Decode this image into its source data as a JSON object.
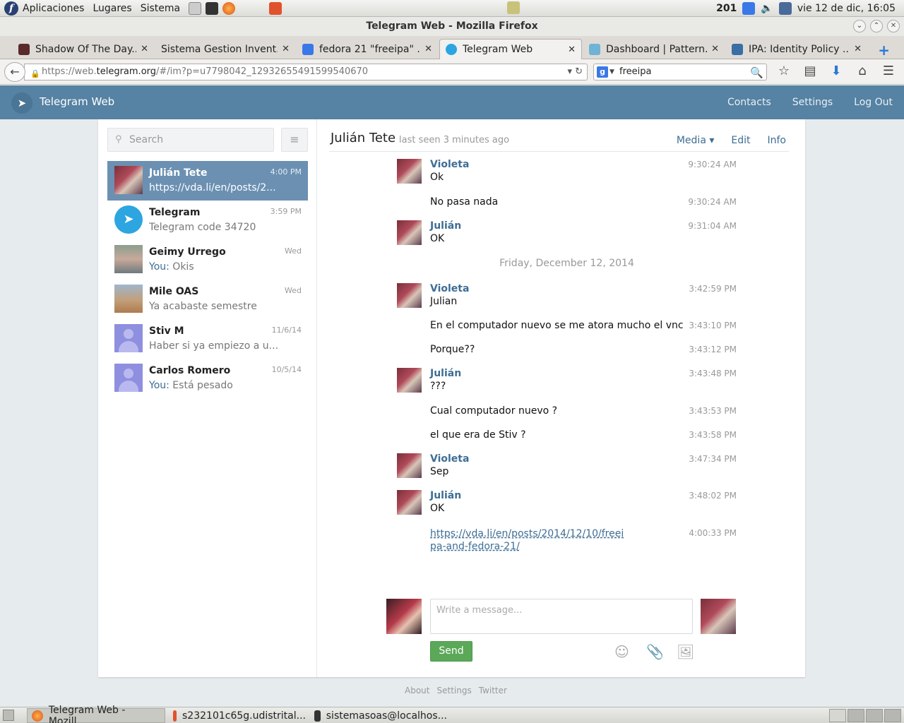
{
  "gnome_panel": {
    "menus": [
      "Aplicaciones",
      "Lugares",
      "Sistema"
    ],
    "tray_number": "201",
    "clock": "vie 12 de dic, 16:05"
  },
  "window": {
    "title": "Telegram Web - Mozilla Firefox"
  },
  "tabs": [
    {
      "title": "Shadow Of The Day...",
      "favicon_color": "#5a2a2a"
    },
    {
      "title": "Sistema Gestion Invent...",
      "favicon_color": "#dedbd6"
    },
    {
      "title": "fedora 21 \"freeipa\" ...",
      "favicon_color": "#3b78e7"
    },
    {
      "title": "Telegram Web",
      "favicon_color": "#2ca5e0"
    },
    {
      "title": "Dashboard | Pattern...",
      "favicon_color": "#6fb3d6"
    },
    {
      "title": "IPA: Identity Policy ...",
      "favicon_color": "#3a6ea5"
    }
  ],
  "nav": {
    "url_prefix": "https://web.",
    "url_host": "telegram.org",
    "url_rest": "/#/im?p=u7798042_12932655491599540670",
    "search_value": "freeipa"
  },
  "tg_header": {
    "brand": "Telegram Web",
    "links": [
      "Contacts",
      "Settings",
      "Log Out"
    ]
  },
  "sidebar": {
    "search_placeholder": "Search",
    "dialogs": [
      {
        "name": "Julián Tete",
        "time": "4:00 PM",
        "you": "",
        "preview": "https://vda.li/en/posts/2...",
        "avatar": "photo-julian",
        "active": true
      },
      {
        "name": "Telegram",
        "time": "3:59 PM",
        "you": "",
        "preview": "Telegram code 34720",
        "avatar": "telegram-logo",
        "active": false
      },
      {
        "name": "Geimy Urrego",
        "time": "Wed",
        "you": "You:",
        "preview": " Okis",
        "avatar": "photo-geimy",
        "active": false
      },
      {
        "name": "Mile OAS",
        "time": "Wed",
        "you": "",
        "preview": "Ya acabaste semestre",
        "avatar": "photo-mile",
        "active": false
      },
      {
        "name": "Stiv M",
        "time": "11/6/14",
        "you": "",
        "preview": "Haber si ya empiezo a u...",
        "avatar": "person-placeholder",
        "active": false
      },
      {
        "name": "Carlos Romero",
        "time": "10/5/14",
        "you": "You:",
        "preview": " Está pesado",
        "avatar": "person-placeholder",
        "active": false
      }
    ]
  },
  "chat": {
    "peer_name": "Julián Tete",
    "peer_status": "last seen 3 minutes ago",
    "actions": [
      "Media ▾",
      "Edit",
      "Info"
    ],
    "date_separator": "Friday, December 12, 2014",
    "messages": [
      {
        "author": "Violeta",
        "text": "Ok",
        "time": "9:30:24 AM"
      },
      {
        "author": "",
        "text": "No pasa nada",
        "time": "9:30:24 AM"
      },
      {
        "author": "Julián",
        "text": "OK",
        "time": "9:31:04 AM"
      },
      {
        "author": "Violeta",
        "text": "Julian",
        "time": "3:42:59 PM"
      },
      {
        "author": "",
        "text": "En el computador nuevo se me atora mucho el vnc",
        "time": "3:43:10 PM"
      },
      {
        "author": "",
        "text": "Porque??",
        "time": "3:43:12 PM"
      },
      {
        "author": "Julián",
        "text": "???",
        "time": "3:43:48 PM"
      },
      {
        "author": "",
        "text": "Cual computador nuevo ?",
        "time": "3:43:53 PM"
      },
      {
        "author": "",
        "text": "el que era de Stiv ?",
        "time": "3:43:58 PM"
      },
      {
        "author": "Violeta",
        "text": "Sep",
        "time": "3:47:34 PM"
      },
      {
        "author": "Julián",
        "text": "OK",
        "time": "3:48:02 PM"
      },
      {
        "author": "",
        "text": "https://vda.li/en/posts/2014/12/10/freeipa-and-fedora-21/",
        "time": "4:00:33 PM"
      }
    ],
    "composer_placeholder": "Write a message...",
    "send_label": "Send"
  },
  "footer_links": [
    "About",
    "Settings",
    "Twitter"
  ],
  "taskbar": {
    "tasks": [
      "Telegram Web - Mozill...",
      "s232101c65g.udistrital...",
      "sistemasoas@localhos..."
    ]
  },
  "colors": {
    "telegram_header": "#5682a3",
    "active_dialog": "#6b90b2",
    "link": "#3e6d95",
    "send_button": "#5ba859"
  }
}
